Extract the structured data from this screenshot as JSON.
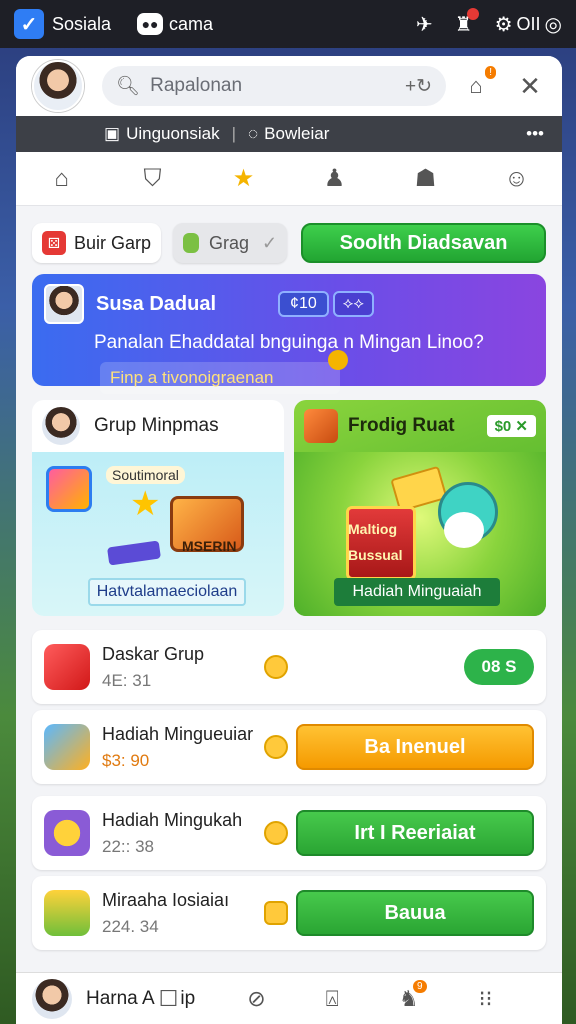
{
  "topbar": {
    "app_name": "Sosiala",
    "chat_label": "cama",
    "status_text": "OII",
    "icons": [
      "check-icon",
      "chat-icon",
      "pin-icon",
      "trophy-icon",
      "settings-icon",
      "search-icon"
    ]
  },
  "header": {
    "search_placeholder": "Rapalonan",
    "icons": [
      "avatar",
      "search-icon",
      "refresh-icon",
      "home-notification-icon",
      "close-icon"
    ],
    "badge": "!"
  },
  "subbar": {
    "item1": "Uinguonsiak",
    "item2": "Bowleiar",
    "more": "•••"
  },
  "nav": {
    "items": [
      "home-icon",
      "shield-icon",
      "star-icon",
      "bell-icon",
      "mask-icon",
      "smile-icon"
    ],
    "active_index": 2
  },
  "filters": {
    "chip1": "Buir Garp",
    "chip2": "Grag",
    "cta": "Soolth Diadsavan"
  },
  "banner": {
    "name": "Susa Dadual",
    "pill1": "¢10",
    "pill2": "⟡⟡",
    "message": "Panalan Ehaddatal bnguinga n Mingan Linoo?",
    "reply": "Finp a tivonoigraenan",
    "colors": {
      "start": "#3a6cf0",
      "end": "#8a45e0"
    }
  },
  "cards": {
    "left": {
      "title": "Grup Minpmas",
      "tag": "Soutimoral",
      "box_text": "MSERIN",
      "label": "Hatvtalamaeciolaan"
    },
    "right": {
      "title": "Frodig Ruat",
      "price": "$0 ✕",
      "box_text_1": "Maltiog",
      "box_text_2": "Bussual",
      "label": "Hadiah Minguaiah"
    }
  },
  "list": [
    {
      "title": "Daskar Grup",
      "sub": "4E: 31",
      "action": "08 S",
      "kind": "small-green"
    },
    {
      "title": "Hadiah Mingueuiar",
      "sub": "$3: 90",
      "action": "Ba Inenuel",
      "kind": "orange"
    },
    {
      "title": "Hadiah Mingukah",
      "sub": "22:: 38",
      "action": "Irt I Reeriaiat",
      "kind": "green"
    },
    {
      "title": "Miraaha Iosiaiaı",
      "sub": "224. 34",
      "action": "Bauua",
      "kind": "green"
    }
  ],
  "bottombar": {
    "name": "Harna A",
    "suffix": "ip",
    "icons": [
      "chat-icon",
      "compass-icon",
      "profile-icon",
      "notification-icon",
      "grid-icon"
    ],
    "badge": "9"
  }
}
